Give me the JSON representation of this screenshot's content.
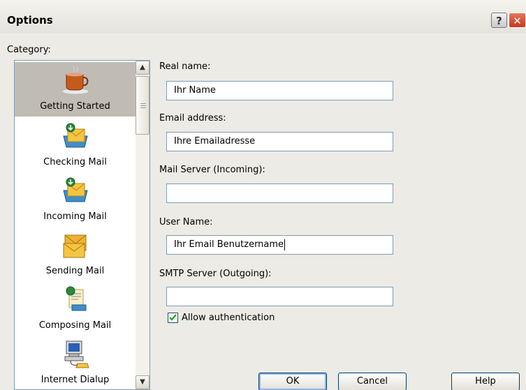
{
  "window": {
    "title": "Options",
    "help_glyph": "?",
    "close_glyph": "✕"
  },
  "category": {
    "label": "Category:",
    "items": [
      {
        "label": "Getting Started",
        "icon": "coffee-cup-icon",
        "selected": true
      },
      {
        "label": "Checking Mail",
        "icon": "checking-mail-icon",
        "selected": false
      },
      {
        "label": "Incoming Mail",
        "icon": "incoming-mail-icon",
        "selected": false
      },
      {
        "label": "Sending Mail",
        "icon": "sending-mail-icon",
        "selected": false
      },
      {
        "label": "Composing Mail",
        "icon": "composing-mail-icon",
        "selected": false
      },
      {
        "label": "Internet Dialup",
        "icon": "internet-dialup-icon",
        "selected": false
      }
    ]
  },
  "form": {
    "real_name_label": "Real name:",
    "real_name_value": "Ihr Name",
    "email_label": "Email address:",
    "email_value": "Ihre Emailadresse",
    "incoming_label": "Mail Server (Incoming):",
    "incoming_value": "",
    "username_label": "User Name:",
    "username_value": "Ihr Email Benutzername",
    "smtp_label": "SMTP Server (Outgoing):",
    "smtp_value": "",
    "allow_auth_label": "Allow authentication",
    "allow_auth_checked": true
  },
  "buttons": {
    "ok": "OK",
    "cancel": "Cancel",
    "help": "Help"
  },
  "scrollbar": {
    "up_glyph": "▲",
    "down_glyph": "▼"
  },
  "colors": {
    "selection": "#c0bcb3",
    "dialog_bg": "#ecebe5",
    "field_border": "#7f9db9"
  }
}
